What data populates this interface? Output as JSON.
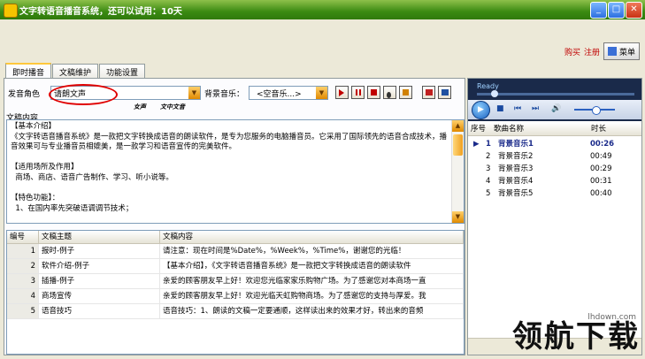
{
  "window": {
    "title": "文字转语音播音系统，还可以试用：10天"
  },
  "header_links": {
    "buy": "购买",
    "register": "注册",
    "menu_label": "菜单"
  },
  "tabs": [
    {
      "label": "即时播音"
    },
    {
      "label": "文稿维护"
    },
    {
      "label": "功能设置"
    }
  ],
  "controls": {
    "voice_label": "发音角色",
    "voice_value": "请朗文声",
    "bgm_label": "背景音乐：",
    "bgm_value": "<空音乐...>",
    "note1": "女声",
    "note2": "文中文音"
  },
  "editor": {
    "label": "文稿内容",
    "content": "【基本介绍】\n《文字转语音播音系统》是一款把文字转换成语音的朗读软件，是专为您服务的电脑播音员。它采用了国际领先的语音合成技术，播音效果可与专业播音员相媲美，是一款学习和语音宣传的完美软件。\n\n【适用场所及作用】\n  商场、商店、语音广告制作、学习、听小说等。\n\n【特色功能】：\n  1、在国内率先突破语调调节技术；"
  },
  "table": {
    "columns": [
      "编号",
      "文稿主题",
      "文稿内容"
    ],
    "rows": [
      [
        "1",
        "报时-例子",
        "请注意：现在时间是%Date%，%Week%，%Time%，谢谢您的光临！"
      ],
      [
        "2",
        "软件介绍-例子",
        "【基本介绍】，《文字转语音播音系统》是一款把文字转换成语音的朗读软件"
      ],
      [
        "3",
        "插播-例子",
        "亲爱的顾客朋友早上好！欢迎您光临家家乐购物广场。为了感谢您对本商场一直"
      ],
      [
        "4",
        "商场宣传",
        "亲爱的顾客朋友早上好！欢迎光临天虹购物商场。为了感谢您的支持与厚爱。我"
      ],
      [
        "5",
        "语音技巧",
        "语音技巧：1、朗读的文稿一定要通顺，这样读出来的效果才好，转出来的音频"
      ]
    ]
  },
  "player": {
    "status": "Ready",
    "columns": [
      "序号",
      "歌曲名称",
      "时长"
    ],
    "tracks": [
      {
        "no": "1",
        "name": "背景音乐1",
        "duration": "00:26"
      },
      {
        "no": "2",
        "name": "背景音乐2",
        "duration": "00:49"
      },
      {
        "no": "3",
        "name": "背景音乐3",
        "duration": "00:29"
      },
      {
        "no": "4",
        "name": "背景音乐4",
        "duration": "00:31"
      },
      {
        "no": "5",
        "name": "背景音乐5",
        "duration": "00:40"
      }
    ],
    "active_track": 1
  },
  "watermark": {
    "text": "领航下载",
    "url": "lhdown.com"
  }
}
